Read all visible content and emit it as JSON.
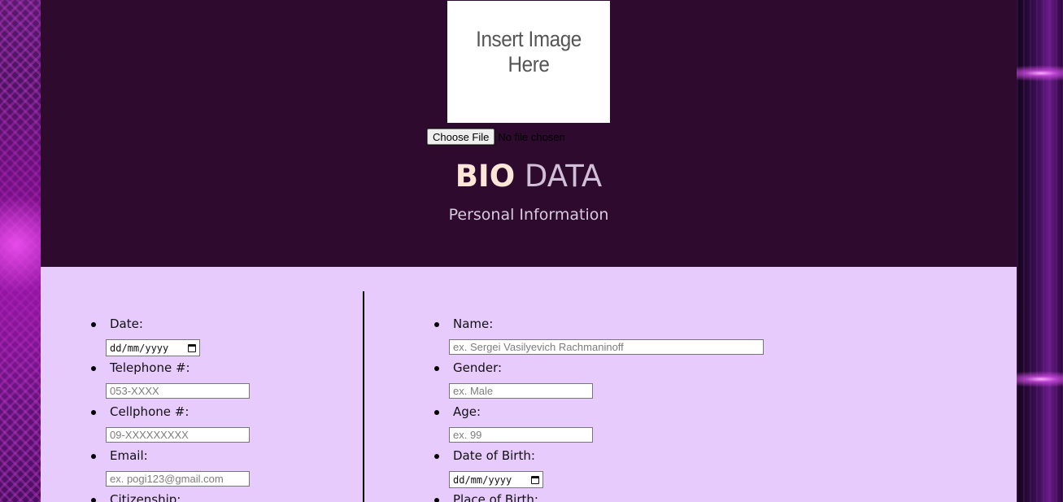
{
  "header": {
    "image_placeholder": "Insert Image Here",
    "file_button": "Choose File",
    "file_status": "No file chosen",
    "title_bold": "BIO",
    "title_light": "DATA",
    "subtitle": "Personal Information"
  },
  "left_fields": [
    {
      "label": "Date:",
      "type": "date",
      "value": "dd/mm/yyyy"
    },
    {
      "label": "Telephone #:",
      "type": "text",
      "placeholder": "053-XXXX"
    },
    {
      "label": "Cellphone #:",
      "type": "text",
      "placeholder": "09-XXXXXXXXX"
    },
    {
      "label": "Email:",
      "type": "text",
      "placeholder": "ex. pogi123@gmail.com"
    },
    {
      "label": "Citizenship:",
      "type": "text",
      "placeholder": ""
    }
  ],
  "right_fields": [
    {
      "label": "Name:",
      "type": "text",
      "placeholder": "ex. Sergei Vasilyevich Rachmaninoff"
    },
    {
      "label": "Gender:",
      "type": "text",
      "placeholder": "ex. Male"
    },
    {
      "label": "Age:",
      "type": "text",
      "placeholder": "ex. 99"
    },
    {
      "label": "Date of Birth:",
      "type": "date",
      "value": "dd/mm/yyyy"
    },
    {
      "label": "Place of Birth:",
      "type": "text",
      "placeholder": ""
    }
  ],
  "colors": {
    "header_bg": "#2e0a2e",
    "content_bg": "#e7cbfd",
    "title_bold": "#fbe6d8",
    "title_light": "#cfc0d8"
  },
  "icons": {
    "date_picker": "calendar-icon"
  }
}
